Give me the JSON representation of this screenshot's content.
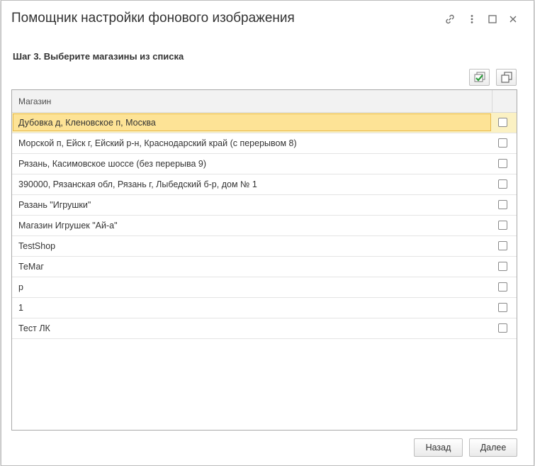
{
  "dialog": {
    "title": "Помощник настройки фонового изображения",
    "step_label": "Шаг 3. Выберите магазины из списка",
    "toolbar": {
      "check_all_icon": "check-all-icon",
      "copy_icon": "copy-icon"
    },
    "title_icons": [
      "link-icon",
      "more-vertical-icon",
      "maximize-icon",
      "close-icon"
    ]
  },
  "table": {
    "columns": [
      "Магазин",
      ""
    ],
    "selected_index": 0,
    "rows": [
      {
        "name": "Дубовка д, Кленовское п, Москва",
        "checked": false
      },
      {
        "name": "Морской п, Ейск г, Ейский р-н, Краснодарский край (с перерывом 8)",
        "checked": false
      },
      {
        "name": "Рязань, Касимовское шоссе (без перерыва 9)",
        "checked": false
      },
      {
        "name": "390000, Рязанская обл, Рязань г, Лыбедский б-р, дом № 1",
        "checked": false
      },
      {
        "name": "Разань \"Игрушки\"",
        "checked": false
      },
      {
        "name": "Магазин Игрушек \"Ай-а\"",
        "checked": false
      },
      {
        "name": "TestShop",
        "checked": false
      },
      {
        "name": "ТеМаг",
        "checked": false
      },
      {
        "name": "р",
        "checked": false
      },
      {
        "name": "1",
        "checked": false
      },
      {
        "name": "Тест ЛК",
        "checked": false
      }
    ]
  },
  "footer": {
    "back_label": "Назад",
    "next_label": "Далее"
  },
  "colors": {
    "selection_fill": "#fde396",
    "selection_border": "#e8b94a",
    "check_icon_green": "#2e9e3e"
  }
}
